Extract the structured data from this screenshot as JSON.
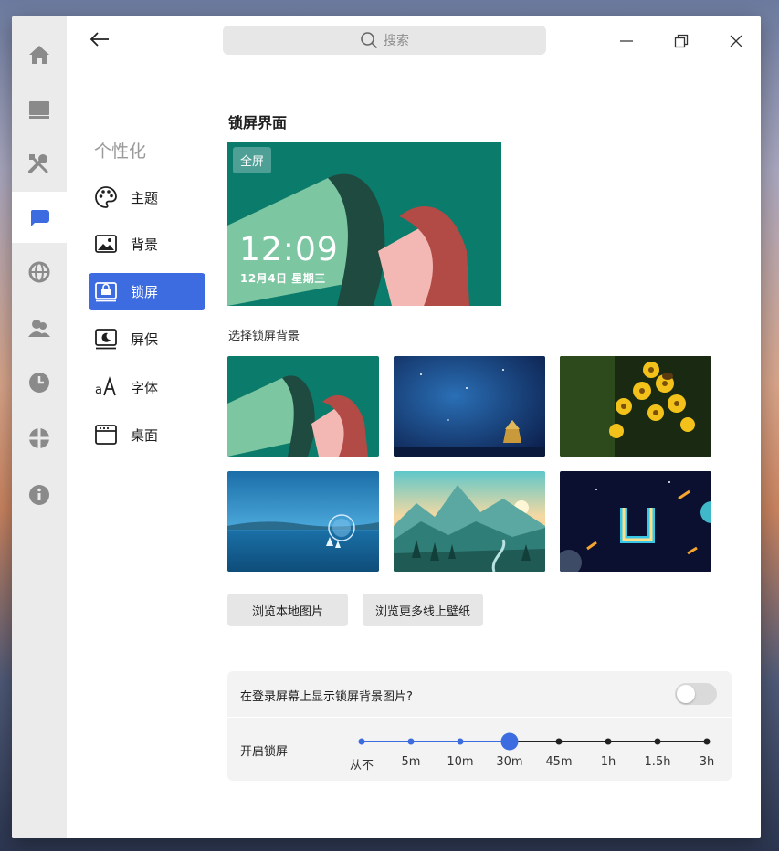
{
  "search": {
    "placeholder": "搜索"
  },
  "sidebar_icons": [
    {
      "name": "home-icon"
    },
    {
      "name": "system-icon"
    },
    {
      "name": "devices-icon"
    },
    {
      "name": "personalization-icon",
      "active": true
    },
    {
      "name": "network-icon"
    },
    {
      "name": "account-icon"
    },
    {
      "name": "datetime-icon"
    },
    {
      "name": "update-icon"
    },
    {
      "name": "about-icon"
    }
  ],
  "nav": {
    "title": "个性化",
    "items": [
      {
        "label": "主题",
        "icon": "palette-icon"
      },
      {
        "label": "背景",
        "icon": "image-icon"
      },
      {
        "label": "锁屏",
        "icon": "lockscreen-icon",
        "active": true
      },
      {
        "label": "屏保",
        "icon": "screensaver-icon"
      },
      {
        "label": "字体",
        "icon": "font-icon"
      },
      {
        "label": "桌面",
        "icon": "desktop-icon"
      }
    ]
  },
  "main": {
    "title": "锁屏界面",
    "preview": {
      "badge": "全屏",
      "time": "12:09",
      "date": "12月4日  星期三"
    },
    "choose_title": "选择锁屏背景",
    "wallpapers": [
      "mint-paper-fold",
      "night-temple",
      "yellow-flowers",
      "blue-lake",
      "mountain-valley",
      "neon-letters"
    ],
    "browse_local": "浏览本地图片",
    "browse_online": "浏览更多线上壁纸",
    "show_on_login": {
      "label": "在登录屏幕上显示锁屏背景图片?",
      "enabled": false
    },
    "lock_after": {
      "label": "开启锁屏",
      "options": [
        "从不",
        "5m",
        "10m",
        "30m",
        "45m",
        "1h",
        "1.5h",
        "3h"
      ],
      "selected_index": 3
    }
  },
  "colors": {
    "accent": "#3d6be0"
  }
}
